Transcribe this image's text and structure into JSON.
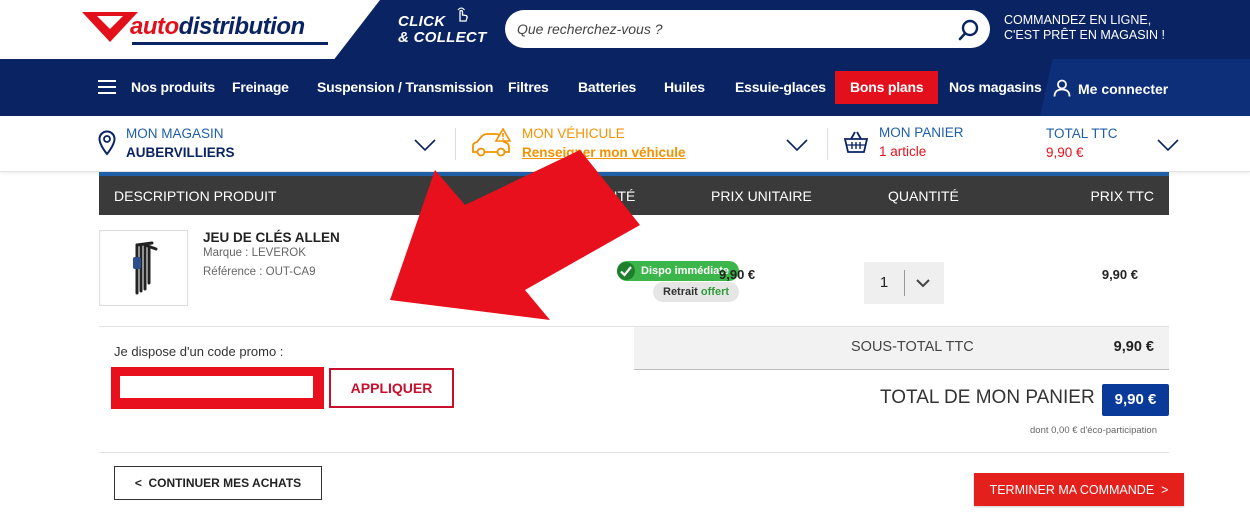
{
  "header": {
    "logo": "autodistribution",
    "logo_part_a": "auto",
    "logo_part_b": "distribution",
    "click_collect_line1": "CLICK",
    "click_collect_line2": "& COLLECT",
    "search_placeholder": "Que recherchez-vous ?",
    "promo_line1": "COMMANDEZ EN LIGNE,",
    "promo_line2": "C'EST PRÊT EN MAGASIN !"
  },
  "nav": {
    "products": "Nos produits",
    "items": [
      "Freinage",
      "Suspension / Transmission",
      "Filtres",
      "Batteries",
      "Huiles",
      "Essuie-glaces"
    ],
    "bons_plans": "Bons plans",
    "magasins": "Nos magasins",
    "login": "Me connecter"
  },
  "infobar": {
    "store_label": "MON MAGASIN",
    "store_value": "AUBERVILLIERS",
    "vehicle_label": "MON VÉHICULE",
    "vehicle_link": "Renseigner mon véhicule",
    "cart_label": "MON PANIER",
    "cart_count": "1 article",
    "total_label": "TOTAL TTC",
    "total_value": "9,90 €"
  },
  "table": {
    "headers": {
      "description": "DESCRIPTION PRODUIT",
      "availability": "DISPONIBILITÉ",
      "unit_price": "PRIX UNITAIRE",
      "quantity": "QUANTITÉ",
      "price": "PRIX TTC"
    },
    "row": {
      "name": "JEU DE CLÉS ALLEN",
      "brand": "Marque : LEVEROK",
      "reference": "Référence : OUT-CA9",
      "dispo": "Dispo immédiate",
      "retrait": "Retrait",
      "offert": "offert",
      "unit_price": "9,90 €",
      "quantity": "1",
      "price": "9,90 €"
    }
  },
  "promo": {
    "label": "Je dispose d'un code promo :",
    "input_value": "",
    "apply": "APPLIQUER"
  },
  "totals": {
    "subtotal_label": "SOUS-TOTAL TTC",
    "subtotal_value": "9,90 €",
    "total_label": "TOTAL DE MON PANIER",
    "total_value": "9,90 €",
    "eco": "dont 0,00 € d'éco-participation"
  },
  "actions": {
    "continue": "CONTINUER MES ACHATS",
    "finish": "TERMINER MA COMMANDE"
  },
  "colors": {
    "brand_navy": "#0a2463",
    "brand_red": "#e3101b",
    "vehicle_orange": "#f39200",
    "available_green": "#3cb54a"
  }
}
